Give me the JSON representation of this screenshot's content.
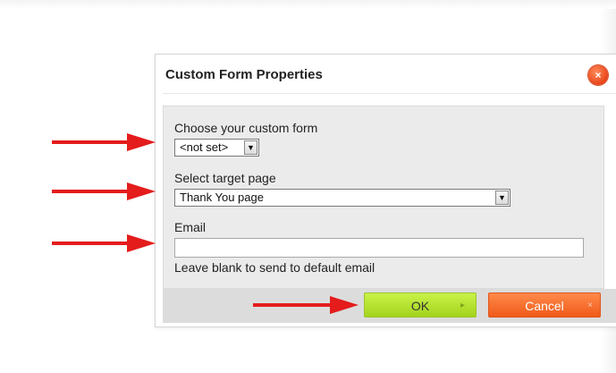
{
  "dialog": {
    "title": "Custom Form Properties",
    "close_symbol": "×",
    "fields": {
      "custom_form": {
        "label": "Choose your custom form",
        "value": "<not set>"
      },
      "target_page": {
        "label": "Select target page",
        "value": "Thank You page"
      },
      "email": {
        "label": "Email",
        "value": "",
        "hint": "Leave blank to send to default email"
      }
    },
    "buttons": {
      "ok": {
        "label": "OK",
        "icon": "▸"
      },
      "cancel": {
        "label": "Cancel",
        "icon": "×"
      }
    }
  },
  "icons": {
    "dropdown": "chevron-down-icon",
    "close": "close-icon",
    "annotation_arrows": "red-arrow-icon"
  },
  "colors": {
    "ok_button": "#b5e32f",
    "cancel_button": "#f26a2a",
    "close_button": "#ee5a2a",
    "annotation_arrow": "#e41c1c"
  }
}
